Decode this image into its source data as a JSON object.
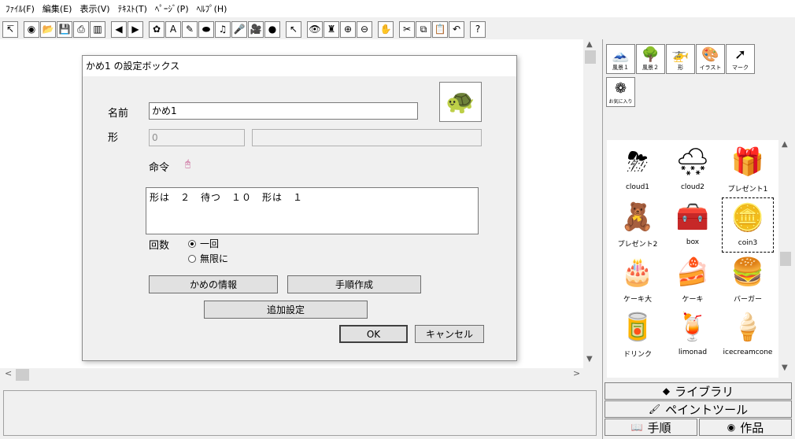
{
  "menu": [
    "ﾌｧｲﾙ(F)",
    "編集(E)",
    "表示(V)",
    "ﾃｷｽﾄ(T)",
    "ﾍﾟｰｼﾞ(P)",
    "ﾍﾙﾌﾟ(H)"
  ],
  "toolbar": [
    {
      "icon": "cursor-arrow-icon",
      "glyph": "↸"
    },
    {
      "icon": "globe-icon",
      "glyph": "◉"
    },
    {
      "icon": "open-folder-icon",
      "glyph": "📂"
    },
    {
      "icon": "save-disk-icon",
      "glyph": "💾"
    },
    {
      "icon": "print-icon",
      "glyph": "⎙"
    },
    {
      "icon": "page-layout-icon",
      "glyph": "▥"
    },
    {
      "icon": "back-arrow-icon",
      "glyph": "◀"
    },
    {
      "icon": "forward-arrow-icon",
      "glyph": "▶"
    },
    {
      "icon": "turtle-icon",
      "glyph": "✿"
    },
    {
      "icon": "text-a-icon",
      "glyph": "A"
    },
    {
      "icon": "pen-line-icon",
      "glyph": "✎"
    },
    {
      "icon": "eraser-icon",
      "glyph": "⬬"
    },
    {
      "icon": "music-note-icon",
      "glyph": "♫"
    },
    {
      "icon": "mic-icon",
      "glyph": "🎤"
    },
    {
      "icon": "video-camera-icon",
      "glyph": "🎥"
    },
    {
      "icon": "sphere-icon",
      "glyph": "●"
    },
    {
      "icon": "pointer-icon",
      "glyph": "↖"
    },
    {
      "icon": "eye-icon",
      "glyph": "👁"
    },
    {
      "icon": "stamp-icon",
      "glyph": "♜"
    },
    {
      "icon": "zoom-in-icon",
      "glyph": "⊕"
    },
    {
      "icon": "zoom-out-icon",
      "glyph": "⊖"
    },
    {
      "icon": "stop-hand-icon",
      "glyph": "✋"
    },
    {
      "icon": "scissors-icon",
      "glyph": "✂"
    },
    {
      "icon": "copy-icon",
      "glyph": "⧉"
    },
    {
      "icon": "paste-icon",
      "glyph": "📋"
    },
    {
      "icon": "undo-icon",
      "glyph": "↶"
    },
    {
      "icon": "help-icon",
      "glyph": "?"
    }
  ],
  "dialog": {
    "title": "かめ1 の設定ボックス",
    "name_label": "名前",
    "name_value": "かめ1",
    "shape_label": "形",
    "shape_value": "0",
    "shape_value2": "",
    "command_label": "命令",
    "command_icon": "mouse-icon",
    "script": "形は　２　待つ　１０　形は　１",
    "count_label": "回数",
    "radio_once": "一回",
    "radio_infinite": "無限に",
    "btn_info": "かめの情報",
    "btn_procedure": "手順作成",
    "btn_extra": "追加設定",
    "btn_ok": "OK",
    "btn_cancel": "キャンセル"
  },
  "categories": [
    {
      "label": "風景１",
      "icon": "mountain-icon",
      "glyph": "🗻"
    },
    {
      "label": "風景２",
      "icon": "tree-icon",
      "glyph": "🌳"
    },
    {
      "label": "形",
      "icon": "helicopter-icon",
      "glyph": "🚁"
    },
    {
      "label": "イラスト",
      "icon": "palette-icon",
      "glyph": "🎨"
    },
    {
      "label": "マーク",
      "icon": "arrow-mark-icon",
      "glyph": "➚"
    }
  ],
  "favorites": {
    "label": "お気に入り",
    "icon": "star-flower-icon",
    "glyph": "❁"
  },
  "gallery": [
    {
      "caption": "cloud1",
      "glyph": "⛈",
      "icon": "storm-cloud-icon",
      "selected": false
    },
    {
      "caption": "cloud2",
      "glyph": "🌨",
      "icon": "snow-cloud-icon",
      "selected": false
    },
    {
      "caption": "プレゼント1",
      "glyph": "🎁",
      "icon": "present-icon",
      "selected": false
    },
    {
      "caption": "プレゼント2",
      "glyph": "🧸",
      "icon": "teddy-present-icon",
      "selected": false
    },
    {
      "caption": "box",
      "glyph": "🧰",
      "icon": "treasure-box-icon",
      "selected": false
    },
    {
      "caption": "coin3",
      "glyph": "🪙",
      "icon": "coin-icon",
      "selected": true
    },
    {
      "caption": "ケーキ大",
      "glyph": "🎂",
      "icon": "birthday-cake-icon",
      "selected": false
    },
    {
      "caption": "ケーキ",
      "glyph": "🍰",
      "icon": "cake-slice-icon",
      "selected": false
    },
    {
      "caption": "バーガー",
      "glyph": "🍔",
      "icon": "burger-icon",
      "selected": false
    },
    {
      "caption": "ドリンク",
      "glyph": "🥫",
      "icon": "drink-can-icon",
      "selected": false
    },
    {
      "caption": "limonad",
      "glyph": "🍹",
      "icon": "lemonade-icon",
      "selected": false
    },
    {
      "caption": "icecreamcone",
      "glyph": "🍦",
      "icon": "ice-cream-icon",
      "selected": false
    }
  ],
  "panel_tabs": {
    "library": "ライブラリ",
    "paint": "ペイントツール",
    "procedure": "手順",
    "works": "作品"
  }
}
